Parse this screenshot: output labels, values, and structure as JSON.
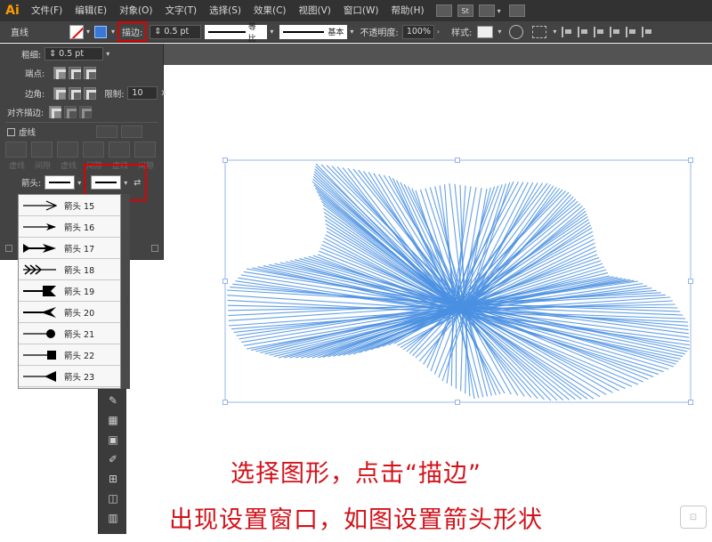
{
  "app": {
    "logo": "Ai"
  },
  "menu": [
    "文件(F)",
    "编辑(E)",
    "对象(O)",
    "文字(T)",
    "选择(S)",
    "效果(C)",
    "视图(V)",
    "窗口(W)",
    "帮助(H)"
  ],
  "menubar_icons": [
    "St"
  ],
  "controlbar": {
    "object_type": "直线",
    "stroke_label": "描边:",
    "stroke_weight": "0.5 pt",
    "profile_label": "等比",
    "brush_label": "基本",
    "opacity_label": "不透明度:",
    "opacity_value": "100%",
    "style_label": "样式:"
  },
  "stroke_panel": {
    "weight_label": "粗细:",
    "weight_value": "0.5 pt",
    "cap_label": "端点:",
    "corner_label": "边角:",
    "limit_label": "限制:",
    "limit_value": "10",
    "limit_suffix": "x",
    "align_label": "对齐描边:",
    "dashed_label": "虚线",
    "dash_headers": [
      "虚线",
      "间隙",
      "虚线",
      "间隙",
      "虚线",
      "间隙"
    ],
    "arrow_label": "箭头:"
  },
  "arrowheads": [
    {
      "label": "箭头 15",
      "icon": "arrow-15-icon"
    },
    {
      "label": "箭头 16",
      "icon": "arrow-16-icon"
    },
    {
      "label": "箭头 17",
      "icon": "arrow-17-icon"
    },
    {
      "label": "箭头 18",
      "icon": "arrow-18-icon"
    },
    {
      "label": "箭头 19",
      "icon": "arrow-19-icon"
    },
    {
      "label": "箭头 20",
      "icon": "arrow-20-icon"
    },
    {
      "label": "箭头 21",
      "icon": "arrow-21-icon"
    },
    {
      "label": "箭头 22",
      "icon": "arrow-22-icon"
    },
    {
      "label": "箭头 23",
      "icon": "arrow-23-icon"
    }
  ],
  "caption": {
    "line1": "选择图形，点击“描边”",
    "line2": "出现设置窗口，如图设置箭头形状"
  },
  "colors": {
    "highlight": "#e00000",
    "artwork_lines": "#4a90e2",
    "caption": "#d2121a",
    "ui_dark": "#434343"
  }
}
